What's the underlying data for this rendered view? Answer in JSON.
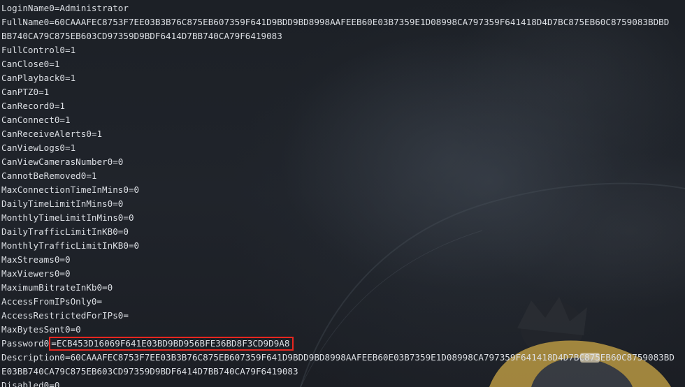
{
  "terminal": {
    "lines": [
      "LoginName0=Administrator",
      "FullName0=60CAAAFEC8753F7EE03B3B76C875EB607359F641D9BDD9BD8998AAFEEB60E03B7359E1D08998CA797359F641418D4D7BC875EB60C8759083BDBD",
      "BB740CA79C875EB603CD97359D9BDF6414D7BB740CA79F6419083",
      "FullControl0=1",
      "CanClose0=1",
      "CanPlayback0=1",
      "CanPTZ0=1",
      "CanRecord0=1",
      "CanConnect0=1",
      "CanReceiveAlerts0=1",
      "CanViewLogs0=1",
      "CanViewCamerasNumber0=0",
      "CannotBeRemoved0=1",
      "MaxConnectionTimeInMins0=0",
      "DailyTimeLimitInMins0=0",
      "MonthlyTimeLimitInMins0=0",
      "DailyTrafficLimitInKB0=0",
      "MonthlyTrafficLimitInKB0=0",
      "MaxStreams0=0",
      "MaxViewers0=0",
      "MaximumBitrateInKb0=0",
      "AccessFromIPsOnly0=",
      "AccessRestrictedForIPs0=",
      "MaxBytesSent0=0"
    ],
    "password_line": {
      "key": "Password0",
      "value": "=ECB453D16069F641E03BD9BD956BFE36BD8F3CD9D9A8"
    },
    "lines_after": [
      "Description0=60CAAAFEC8753F7EE03B3B76C875EB607359F641D9BDD9BD8998AAFEEB60E03B7359E1D08998CA797359F641418D4D7BC875EB60C8759083BD",
      "E03BB740CA79C875EB603CD97359D9BDF6414D7BB740CA79F6419083",
      "Disabled0=0"
    ],
    "highlight_color": "#e8261f",
    "text_color": "#dcdfe4"
  }
}
